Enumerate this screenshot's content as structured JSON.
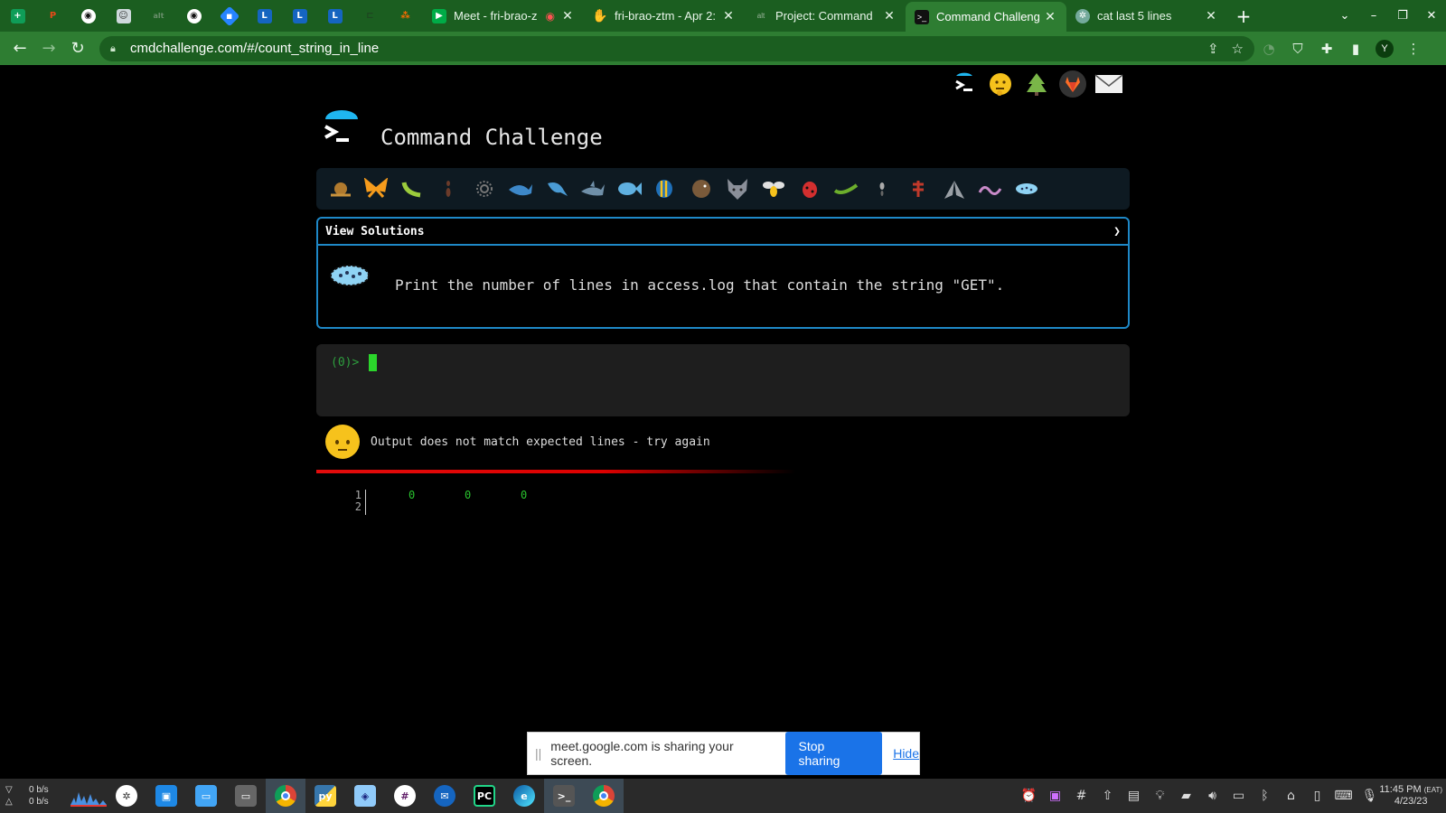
{
  "browser": {
    "tabs": [
      {
        "title": "Meet - fri-brao-z",
        "icon": "meet-icon"
      },
      {
        "title": "fri-brao-ztm - Apr 2:",
        "icon": "hand-icon"
      },
      {
        "title": "Project: Command",
        "icon": "project-icon"
      },
      {
        "title": "Command Challeng",
        "icon": "terminal-icon",
        "active": true
      },
      {
        "title": "cat last 5 lines",
        "icon": "chatgpt-icon"
      }
    ],
    "url": "cmdchallenge.com/#/count_string_in_line",
    "profile_initial": "Y"
  },
  "site": {
    "title": "Command Challenge"
  },
  "panel": {
    "header": "View Solutions",
    "toggle": "❯",
    "task": "Print the number of lines in access.log that contain the string \"GET\"."
  },
  "terminal": {
    "prompt": "(0)>"
  },
  "result": {
    "message": "Output does not match expected lines - try again",
    "status_color": "#e20c0c"
  },
  "output": {
    "line_numbers": [
      "1",
      "2"
    ],
    "values": [
      "0",
      "0",
      "0"
    ]
  },
  "share_bar": {
    "text": "meet.google.com is sharing your screen.",
    "stop_label": "Stop sharing",
    "hide_label": "Hide"
  },
  "taskbar": {
    "net_down": "0 b/s",
    "net_up": "0 b/s",
    "time": "11:45 PM",
    "tz": "(EAT)",
    "date": "4/23/23"
  }
}
